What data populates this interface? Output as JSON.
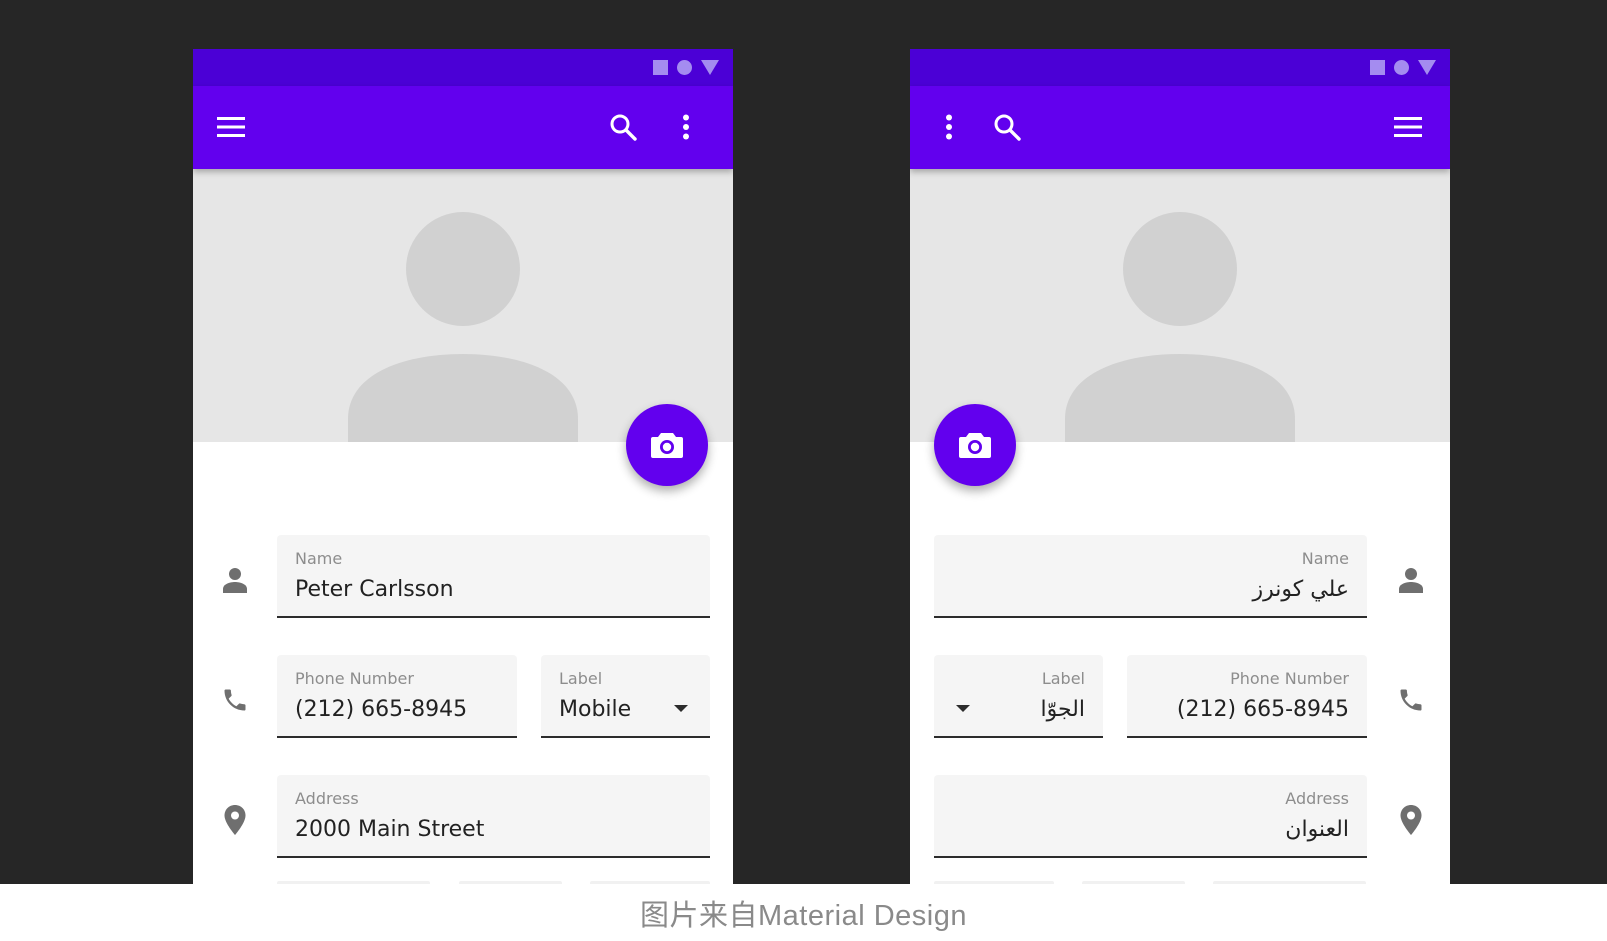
{
  "caption": "图片来自Material Design",
  "colors": {
    "primary": "#6200ee",
    "status_bar": "#4b00d6",
    "background": "#262626",
    "hero": "#e6e6e6",
    "field_fill": "#f5f5f5"
  },
  "ltr": {
    "name_label": "Name",
    "name_value": "Peter Carlsson",
    "phone_label": "Phone Number",
    "phone_value": "(212) 665-8945",
    "type_label": "Label",
    "type_value": "Mobile",
    "address_label": "Address",
    "address_value": "2000 Main Street"
  },
  "rtl": {
    "name_label": "Name",
    "name_value": "علي كونرز",
    "phone_label": "Phone Number",
    "phone_value": "(212) 665-8945",
    "type_label": "Label",
    "type_value": "الجوّا",
    "address_label": "Address",
    "address_value": "العنوان"
  },
  "icons": [
    "menu-icon",
    "search-icon",
    "more-vert-icon",
    "camera-icon",
    "person-icon",
    "phone-icon",
    "location-pin-icon",
    "dropdown-arrow-icon"
  ]
}
